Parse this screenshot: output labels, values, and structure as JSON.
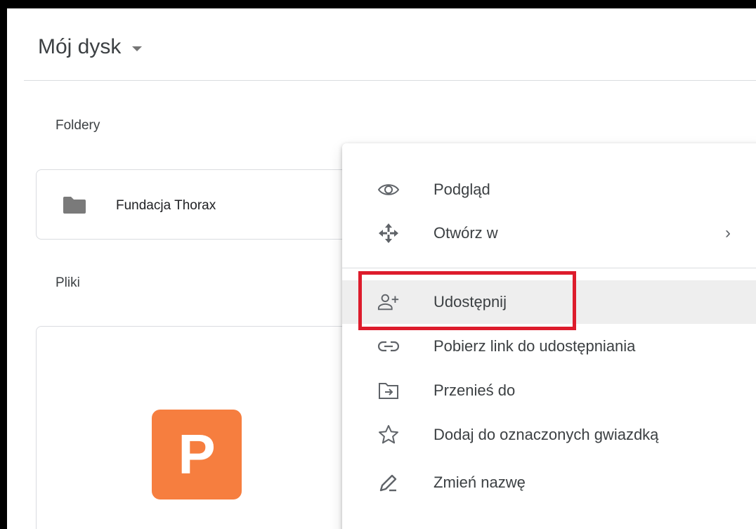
{
  "header": {
    "title": "Mój dysk"
  },
  "sections": {
    "folders_label": "Foldery",
    "files_label": "Pliki"
  },
  "folder": {
    "name": "Fundacja Thorax"
  },
  "file": {
    "badge_letter": "P",
    "badge_color": "#f67e3f"
  },
  "context_menu": {
    "items": [
      {
        "label": "Podgląd",
        "icon": "eye-icon"
      },
      {
        "label": "Otwórz w",
        "icon": "open-with-icon",
        "chevron": "›"
      },
      {
        "label": "Udostępnij",
        "icon": "share-person-add-icon",
        "highlighted": true
      },
      {
        "label": "Pobierz link do udostępniania",
        "icon": "link-icon"
      },
      {
        "label": "Przenieś do",
        "icon": "move-to-folder-icon"
      },
      {
        "label": "Dodaj do oznaczonych gwiazdką",
        "icon": "star-icon"
      },
      {
        "label": "Zmień nazwę",
        "icon": "rename-pencil-icon"
      }
    ]
  },
  "colors": {
    "highlight": "#dd1c2c",
    "hover_row": "#eeeeee"
  }
}
